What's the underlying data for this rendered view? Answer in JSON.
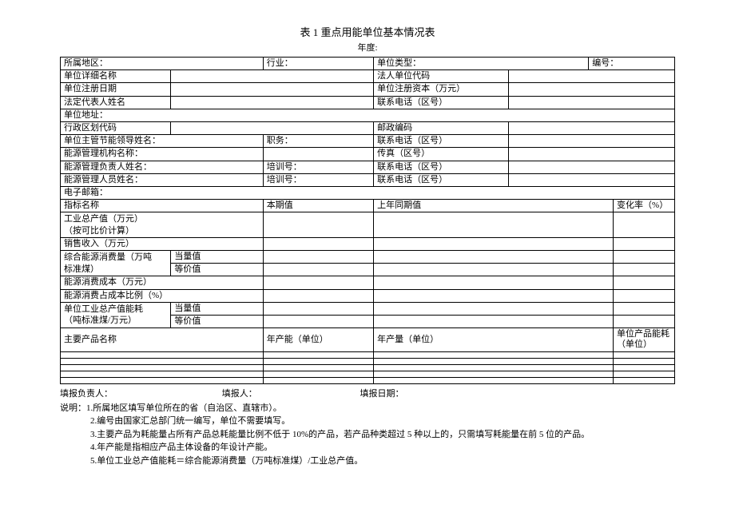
{
  "title": "表 1  重点用能单位基本情况表",
  "subtitle": "年度:",
  "row1": {
    "c1": "所属地区：",
    "c2": "行业：",
    "c3": "单位类型：",
    "c4": "编号："
  },
  "row2": {
    "c1": "单位详细名称",
    "c2": "法人单位代码"
  },
  "row3": {
    "c1": "单位注册日期",
    "c2": "单位注册资本（万元）"
  },
  "row4": {
    "c1": "法定代表人姓名",
    "c2": "联系电话（区号）"
  },
  "row5": {
    "c1": "单位地址："
  },
  "row6": {
    "c1": "行政区划代码",
    "c2": "邮政编码"
  },
  "row7": {
    "c1": "单位主管节能领导姓名：",
    "c2": "职务：",
    "c3": "联系电话（区号）"
  },
  "row8": {
    "c1": "能源管理机构名称：",
    "c2": "传真（区号）"
  },
  "row9": {
    "c1": "能源管理负责人姓名：",
    "c2": "培训号：",
    "c3": "联系电话（区号）"
  },
  "row10": {
    "c1": "能源管理人员姓名：",
    "c2": "培训号：",
    "c3": "联系电话（区号）"
  },
  "row11": {
    "c1": "电子邮箱："
  },
  "hdr1": {
    "c1": "指标名称",
    "c2": "本期值",
    "c3": "上年同期值",
    "c4": "变化率（%）"
  },
  "ind1": {
    "c1": "工业总产值（万元）",
    "c2": "（按可比价计算）"
  },
  "ind2": "销售收入（万元）",
  "ind3": {
    "c1": "综合能源消费量（万吨",
    "c2": "标准煤）",
    "s1": "当量值",
    "s2": "等价值"
  },
  "ind4": "能源消费成本（万元）",
  "ind5": "能源消费占成本比例（%）",
  "ind6": {
    "c1": "单位工业总产值能耗",
    "c2": "（吨标准煤/万元）",
    "s1": "当量值",
    "s2": "等价值"
  },
  "hdr2": {
    "c1": "主要产品名称",
    "c2": "年产能（单位）",
    "c3": "年产量（单位）",
    "c4": "单位产品能耗（单位）"
  },
  "footer": {
    "c1": "填报负责人：",
    "c2": "填报人：",
    "c3": "填报日期："
  },
  "notes": {
    "lead": "说明：",
    "n1": "1.所属地区填写单位所在的省（自治区、直辖市）。",
    "n2": "2.编号由国家汇总部门统一编写，单位不需要填写。",
    "n3": "3.主要产品为耗能量占所有产品总耗能量比例不低于 10%的产品，若产品种类超过 5 种以上的，只需填写耗能量在前 5 位的产品。",
    "n4": "4.年产能是指相应产品主体设备的年设计产能。",
    "n5": "5.单位工业总产值能耗＝综合能源消费量（万吨标准煤）/工业总产值。"
  }
}
